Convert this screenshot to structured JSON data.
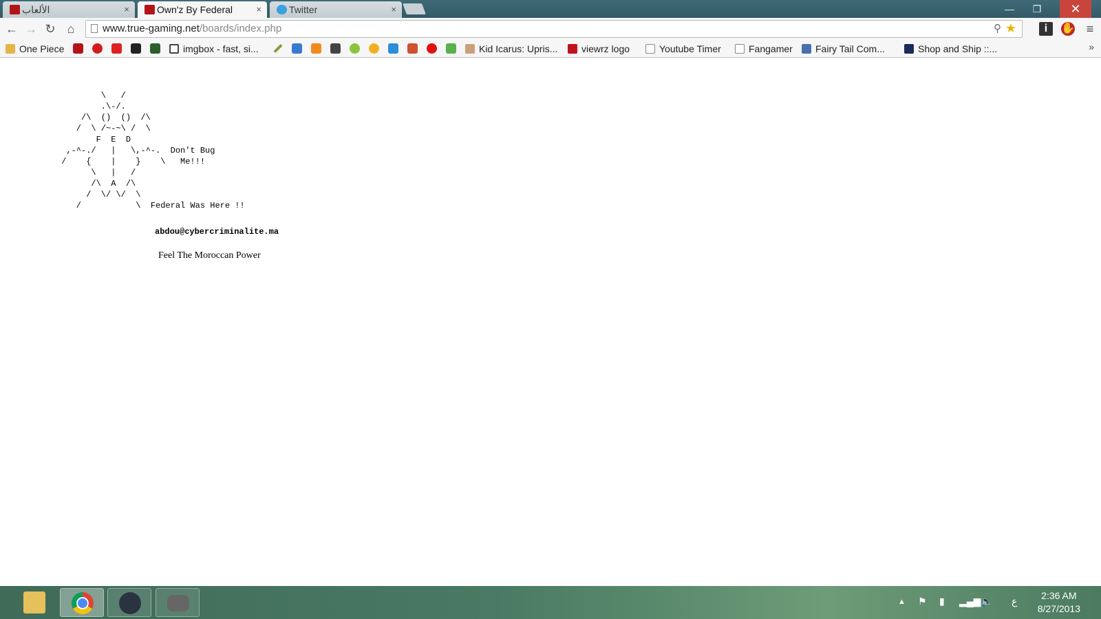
{
  "browser": {
    "tabs": [
      {
        "title": "الألعاب",
        "active": false
      },
      {
        "title": "Own'z By Federal",
        "active": true
      },
      {
        "title": "Twitter",
        "active": false
      }
    ],
    "close_glyph": "×",
    "url_host": "www.true-gaming.net",
    "url_path": "/boards/index.php"
  },
  "bookmarks": [
    {
      "label": "One Piece",
      "icon": "folder-icon"
    },
    {
      "label": "imgbox - fast, si...",
      "icon": "imgbox-icon"
    },
    {
      "label": "Kid Icarus: Upris...",
      "icon": "kid-icarus-icon"
    },
    {
      "label": "viewrz logo",
      "icon": "viewrz-icon"
    },
    {
      "label": "Youtube Timer",
      "icon": "page-icon"
    },
    {
      "label": "Fangamer",
      "icon": "page-icon"
    },
    {
      "label": "Fairy Tail Com...",
      "icon": "pencil-icon"
    },
    {
      "label": "Shop and Ship ::...",
      "icon": "shopandship-icon"
    }
  ],
  "page": {
    "ascii_art": "         \\   /\n         .\\-/.\n     /\\  ()  ()  /\\\n    /  \\ /~-~\\ /  \\\n        F  E  D\n  ,-^-./   |   \\,-^-.  Don't Bug\n /    {    |    }    \\   Me!!!\n       \\   |   /\n       /\\  A  /\\\n      /  \\/ \\/  \\\n    /           \\  Federal Was Here !!",
    "email": "abdou@cybercriminalite.ma",
    "tagline": "Feel The Moroccan Power"
  },
  "taskbar": {
    "apps": [
      {
        "name": "file-explorer",
        "active": false
      },
      {
        "name": "chrome",
        "active": true
      },
      {
        "name": "steam",
        "active": false
      },
      {
        "name": "gamepad-app",
        "active": false
      }
    ],
    "language": "ع",
    "time": "2:36 AM",
    "date": "8/27/2013"
  },
  "colors": {
    "tab_strip": "#3f6a78",
    "close_button": "#c9453c",
    "taskbar": "#4a7a63"
  }
}
